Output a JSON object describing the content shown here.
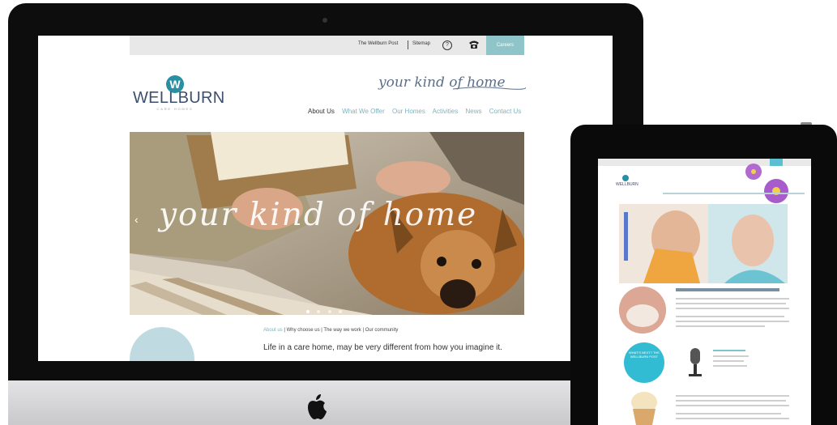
{
  "topbar": {
    "post_link": "The Wellburn Post",
    "sitemap_link": "Sitemap",
    "help_icon": "question-circle-icon",
    "help_glyph": "?",
    "phone_icon": "phone-icon",
    "careers_button": "Careers"
  },
  "brand": {
    "logo_letter": "W",
    "name": "WELLBURN",
    "sub": "CARE HOMES",
    "tagline": "your kind of home",
    "accent": "#2b8fa3",
    "nav_color": "#7fb3bd"
  },
  "nav": {
    "items": [
      "About Us",
      "What We Offer",
      "Our Homes",
      "Activities",
      "News",
      "Contact Us"
    ],
    "active": "About Us"
  },
  "hero": {
    "overlay_text": "your kind of home",
    "slide_count": 4,
    "active_slide": 1
  },
  "subnav": {
    "items": [
      "About us",
      "Why choose us",
      "The way we work",
      "Our community"
    ],
    "separator": "|"
  },
  "intro": {
    "text": "Life in a care home, may be very different from how you imagine it."
  },
  "ipad": {
    "logo_name": "WELLBURN",
    "promo_text": "WHAT'S NEXT? THE WELLBURN POST"
  },
  "device": {
    "logo_icon": "apple-logo-icon"
  }
}
